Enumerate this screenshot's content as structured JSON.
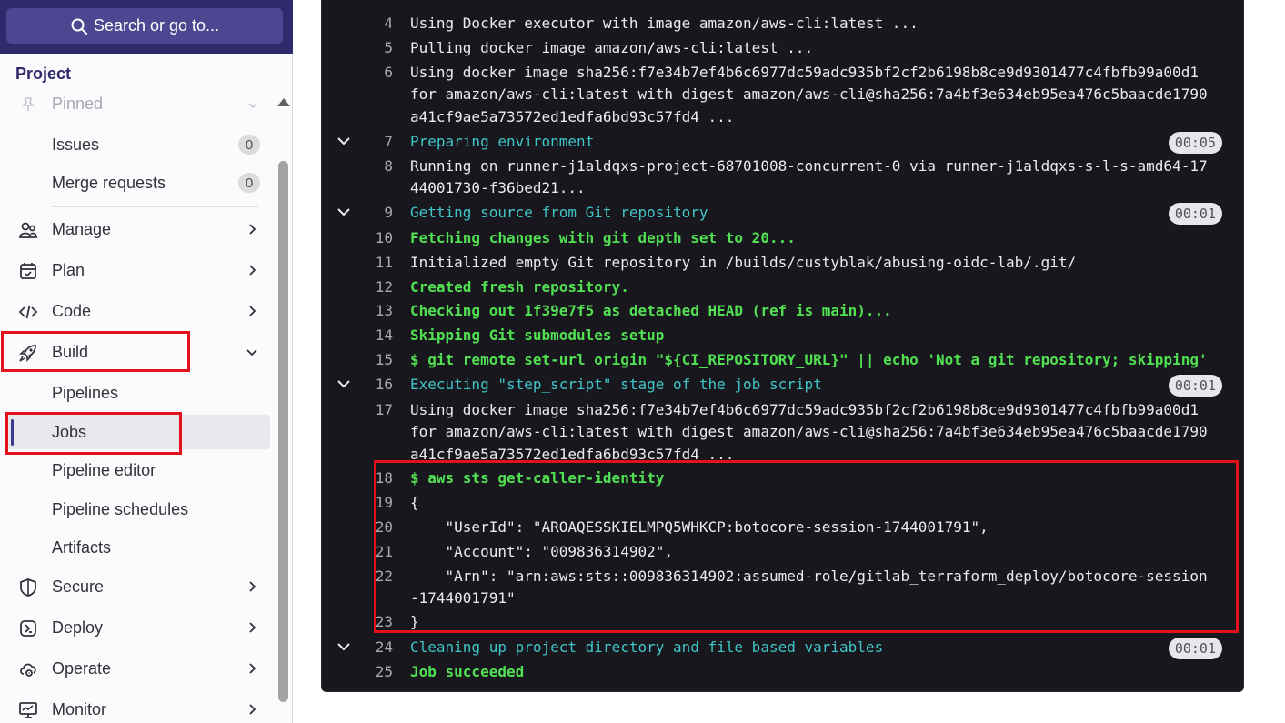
{
  "sidebar": {
    "search_label": "Search or go to...",
    "section_title": "Project",
    "pinned_label": "Pinned",
    "items": {
      "issues": {
        "label": "Issues",
        "count": "0"
      },
      "merge_requests": {
        "label": "Merge requests",
        "count": "0"
      },
      "manage": "Manage",
      "plan": "Plan",
      "code": "Code",
      "build": "Build",
      "pipelines": "Pipelines",
      "jobs": "Jobs",
      "pipeline_editor": "Pipeline editor",
      "pipeline_schedules": "Pipeline schedules",
      "artifacts": "Artifacts",
      "secure": "Secure",
      "deploy": "Deploy",
      "operate": "Operate",
      "monitor": "Monitor"
    }
  },
  "log": {
    "lines": [
      {
        "n": "4",
        "text": "Using Docker executor with image amazon/aws-cli:latest ...",
        "style": "white"
      },
      {
        "n": "5",
        "text": "Pulling docker image amazon/aws-cli:latest ...",
        "style": "white"
      },
      {
        "n": "6",
        "text": "Using docker image sha256:f7e34b7ef4b6c6977dc59adc935bf2cf2b6198b8ce9d9301477c4fbfb99a00d1",
        "style": "white"
      },
      {
        "n": "",
        "text": "for amazon/aws-cli:latest with digest amazon/aws-cli@sha256:7a4bf3e634eb95ea476c5baacde1790",
        "style": "white"
      },
      {
        "n": "",
        "text": "a41cf9ae5a73572ed1edfa6bd93c57fd4 ...",
        "style": "white"
      },
      {
        "n": "7",
        "text": "Preparing environment",
        "style": "cyan",
        "section": true,
        "duration": "00:05"
      },
      {
        "n": "8",
        "text": "Running on runner-j1aldqxs-project-68701008-concurrent-0 via runner-j1aldqxs-s-l-s-amd64-17",
        "style": "white"
      },
      {
        "n": "",
        "text": "44001730-f36bed21...",
        "style": "white"
      },
      {
        "n": "9",
        "text": "Getting source from Git repository",
        "style": "cyan",
        "section": true,
        "duration": "00:01"
      },
      {
        "n": "10",
        "text": "Fetching changes with git depth set to 20...",
        "style": "green"
      },
      {
        "n": "11",
        "text": "Initialized empty Git repository in /builds/custyblak/abusing-oidc-lab/.git/",
        "style": "white"
      },
      {
        "n": "12",
        "text": "Created fresh repository.",
        "style": "green"
      },
      {
        "n": "13",
        "text": "Checking out 1f39e7f5 as detached HEAD (ref is main)...",
        "style": "green"
      },
      {
        "n": "14",
        "text": "Skipping Git submodules setup",
        "style": "green"
      },
      {
        "n": "15",
        "text": "$ git remote set-url origin \"${CI_REPOSITORY_URL}\" || echo 'Not a git repository; skipping'",
        "style": "green"
      },
      {
        "n": "16",
        "text": "Executing \"step_script\" stage of the job script",
        "style": "cyan",
        "section": true,
        "duration": "00:01"
      },
      {
        "n": "17",
        "text": "Using docker image sha256:f7e34b7ef4b6c6977dc59adc935bf2cf2b6198b8ce9d9301477c4fbfb99a00d1",
        "style": "white"
      },
      {
        "n": "",
        "text": "for amazon/aws-cli:latest with digest amazon/aws-cli@sha256:7a4bf3e634eb95ea476c5baacde1790",
        "style": "white"
      },
      {
        "n": "",
        "text": "a41cf9ae5a73572ed1edfa6bd93c57fd4 ...",
        "style": "white"
      },
      {
        "n": "18",
        "text": "$ aws sts get-caller-identity",
        "style": "green"
      },
      {
        "n": "19",
        "text": "{",
        "style": "white"
      },
      {
        "n": "20",
        "text": "    \"UserId\": \"AROAQESSKIELMPQ5WHKCP:botocore-session-1744001791\",",
        "style": "white"
      },
      {
        "n": "21",
        "text": "    \"Account\": \"009836314902\",",
        "style": "white"
      },
      {
        "n": "22",
        "text": "    \"Arn\": \"arn:aws:sts::009836314902:assumed-role/gitlab_terraform_deploy/botocore-session",
        "style": "white"
      },
      {
        "n": "",
        "text": "-1744001791\"",
        "style": "white"
      },
      {
        "n": "23",
        "text": "}",
        "style": "white"
      },
      {
        "n": "24",
        "text": "Cleaning up project directory and file based variables",
        "style": "cyan",
        "section": true,
        "duration": "00:01"
      },
      {
        "n": "25",
        "text": "Job succeeded",
        "style": "green"
      }
    ]
  },
  "colors": {
    "sidebar_top": "#2f2a6b",
    "log_background": "#18171d",
    "section_cyan": "#3fc6c8",
    "success_green": "#51e052",
    "highlight_red": "#e3111b"
  }
}
